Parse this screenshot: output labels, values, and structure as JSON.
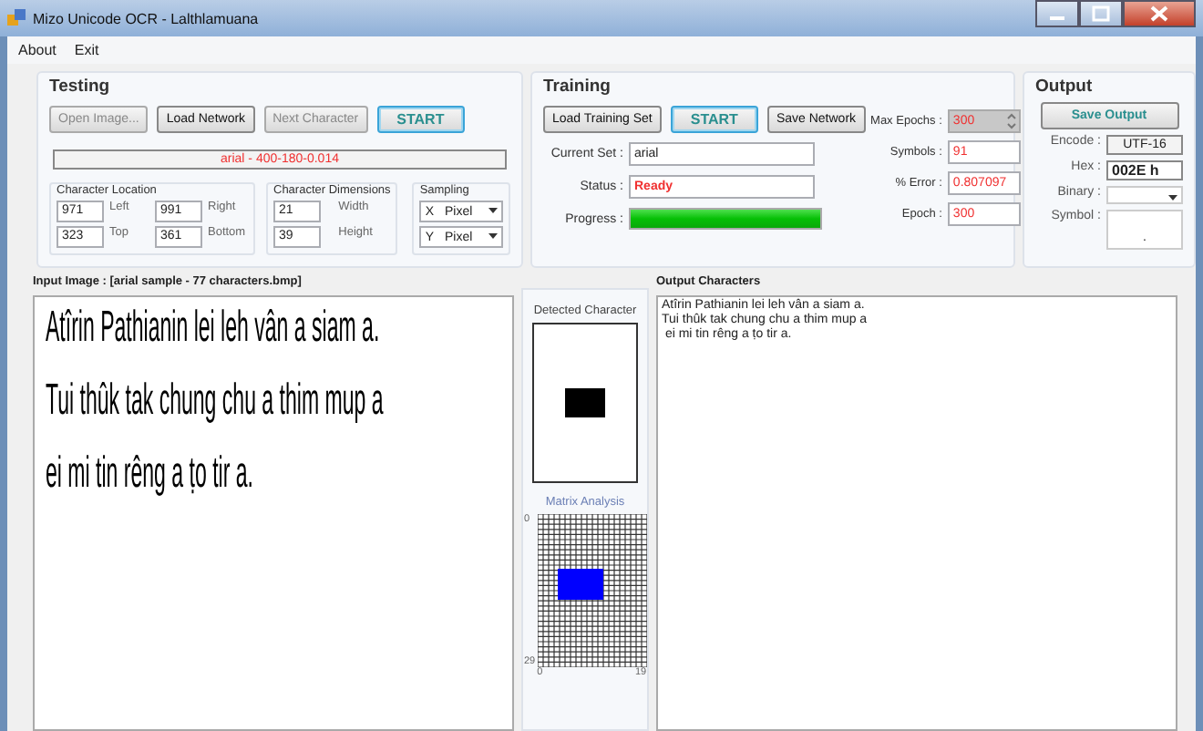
{
  "window": {
    "title": "Mizo Unicode OCR - Lalthlamuana"
  },
  "menu": [
    {
      "label": "About"
    },
    {
      "label": "Exit"
    }
  ],
  "testing": {
    "title": "Testing",
    "buttons": [
      {
        "label": "Open Image...",
        "disabled": true,
        "kind": "normal"
      },
      {
        "label": "Load Network",
        "disabled": false,
        "kind": "normal"
      },
      {
        "label": "Next Character",
        "disabled": true,
        "kind": "normal"
      },
      {
        "label": "START",
        "disabled": false,
        "kind": "accent"
      }
    ],
    "info": "arial - 400-180-0.014",
    "location": {
      "title": "Character Location",
      "fields": [
        {
          "value": "971",
          "label": "Left"
        },
        {
          "value": "991",
          "label": "Right"
        },
        {
          "value": "323",
          "label": "Top"
        },
        {
          "value": "361",
          "label": "Bottom"
        }
      ]
    },
    "dimensions": {
      "title": "Character Dimensions",
      "fields": [
        {
          "value": "21",
          "label": "Width"
        },
        {
          "value": "39",
          "label": "Height"
        }
      ]
    },
    "sampling": {
      "title": "Sampling",
      "selects": [
        {
          "axis": "X",
          "value": "Pixel"
        },
        {
          "axis": "Y",
          "value": "Pixel"
        }
      ]
    }
  },
  "training": {
    "title": "Training",
    "buttons": [
      {
        "label": "Load Training Set",
        "kind": "normal"
      },
      {
        "label": "START",
        "kind": "accent"
      },
      {
        "label": "Save Network",
        "kind": "normal"
      }
    ],
    "current_set": {
      "label": "Current Set :",
      "value": "arial"
    },
    "status": {
      "label": "Status :",
      "value": "Ready"
    },
    "progress": {
      "label": "Progress :",
      "level": 1
    },
    "max_epochs": {
      "label": "Max Epochs :",
      "value": "300",
      "disabled": true
    },
    "stats": [
      {
        "label": "Symbols :",
        "value": "91"
      },
      {
        "label": "% Error :",
        "value": "0.807097"
      },
      {
        "label": "Epoch :",
        "value": "300"
      }
    ]
  },
  "output": {
    "title": "Output",
    "button": "Save Output",
    "encode": {
      "label": "Encode :",
      "value": "UTF-16"
    },
    "hex": {
      "label": "Hex :",
      "value": "002E h"
    },
    "binary": {
      "label": "Binary :"
    },
    "symbol": {
      "label": "Symbol :",
      "value": "."
    }
  },
  "input_image": {
    "title": "Input Image : [arial sample - 77 characters.bmp]",
    "lines": [
      "Atîrin Pathianin lei leh vân a siam a.",
      "Tui thûk tak chung chu a thim mup a",
      "ei mi tin rêng a ṭo tir a."
    ]
  },
  "detected": {
    "title": "Detected Character"
  },
  "matrix": {
    "title": "Matrix Analysis",
    "y_ticks": [
      "0",
      "29"
    ],
    "x_ticks": [
      "0",
      "19"
    ]
  },
  "output_characters": {
    "title": "Output Characters",
    "lines": [
      "Atîrin Pathianin lei leh vân a siam a.",
      "Tui thûk tak chung chu a thim mup a",
      " ei mi tin rêng a ṭo tir a."
    ]
  }
}
